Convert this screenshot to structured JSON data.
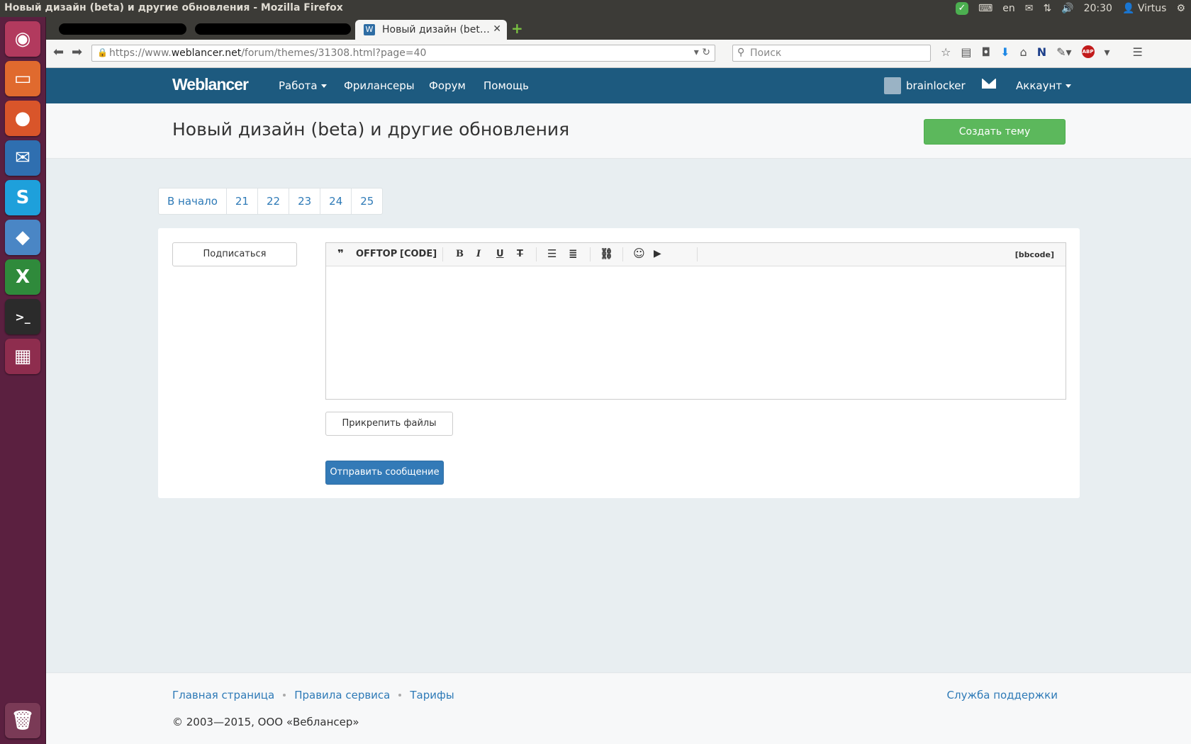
{
  "system": {
    "window_title": "Новый дизайн (beta) и другие обновления - Mozilla Firefox",
    "keyboard_layout": "en",
    "clock": "20:30",
    "user": "Virtus"
  },
  "browser": {
    "active_tab_title": "Новый дизайн (bet…",
    "url_host_prefix": "https://www.",
    "url_host": "weblancer.net",
    "url_path": "/forum/themes/31308.html?page=40",
    "search_placeholder": "Поиск"
  },
  "site": {
    "logo": "Weblancer",
    "nav": {
      "work": "Работа",
      "freelancers": "Фрилансеры",
      "forum": "Форум",
      "help": "Помощь"
    },
    "username": "brainlocker",
    "account": "Аккаунт"
  },
  "topic": {
    "title": "Новый дизайн (beta) и другие обновления",
    "create_button": "Создать тему"
  },
  "pagination": [
    "В начало",
    "21",
    "22",
    "23",
    "24",
    "25"
  ],
  "post_form": {
    "subscribe": "Подписаться",
    "toolbar": {
      "quote": "❞",
      "offtop": "OFFTOP",
      "code": "[CODE]",
      "bold": "B",
      "italic": "I",
      "underline": "U",
      "strike": "T",
      "bbcode": "[bbcode]"
    },
    "attach_files": "Прикрепить файлы",
    "send": "Отправить сообщение"
  },
  "footer": {
    "links": [
      "Главная страница",
      "Правила сервиса",
      "Тарифы"
    ],
    "support": "Служба поддержки",
    "copyright": "© 2003—2015, ООО «Веблансер»"
  }
}
